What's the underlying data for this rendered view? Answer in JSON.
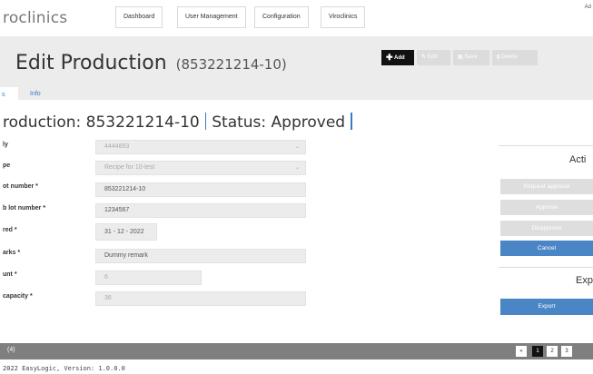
{
  "navbar": {
    "brand": "roclinics",
    "items": [
      {
        "label": "Dashboard"
      },
      {
        "label": "User Management"
      },
      {
        "label": "Configuration"
      },
      {
        "label": "Viroclinics"
      }
    ],
    "user_line1": "Ad"
  },
  "header": {
    "title": "Edit Production",
    "subtitle": "(853221214-10)",
    "toolbar": {
      "add": "Add",
      "edit": "Edit",
      "save": "Save",
      "delete": "Delete"
    }
  },
  "tabs": {
    "active": "s",
    "info": "Info"
  },
  "heading": {
    "production": "roduction: 853221214-10",
    "status": "Status: Approved"
  },
  "form": {
    "fields": [
      {
        "label": "ly",
        "value": "4444853",
        "type": "select",
        "disabled": true
      },
      {
        "label": "pe",
        "value": "Recipe for 10-test",
        "type": "select",
        "disabled": true
      },
      {
        "label": "ot number *",
        "value": "853221214-10",
        "type": "text"
      },
      {
        "label": "b lot number *",
        "value": "1234567",
        "type": "text"
      },
      {
        "label": "red *",
        "value": "31 - 12 - 2022",
        "type": "date"
      },
      {
        "label": "arks *",
        "value": "Dummy remark",
        "type": "text"
      },
      {
        "label": "unt *",
        "value": "6",
        "type": "text",
        "disabled": true
      },
      {
        "label": "capacity *",
        "value": "36",
        "type": "text",
        "disabled": true
      }
    ]
  },
  "actions": {
    "title": "Acti",
    "request_approval": "Request approval",
    "approve": "Approve",
    "disapprove": "Disapprove",
    "cancel": "Cancel"
  },
  "export": {
    "title": "Exp",
    "button": "Export"
  },
  "footer": {
    "count": "(4)",
    "pagination": [
      "«",
      "1",
      "2",
      "3"
    ],
    "copyright": "2022 EasyLogic, Version: 1.0.0.0"
  },
  "colors": {
    "primary": "#4a86c5",
    "link": "#3a7bbf",
    "footer_bg": "#7f7f7f",
    "band_bg": "#ececec"
  }
}
